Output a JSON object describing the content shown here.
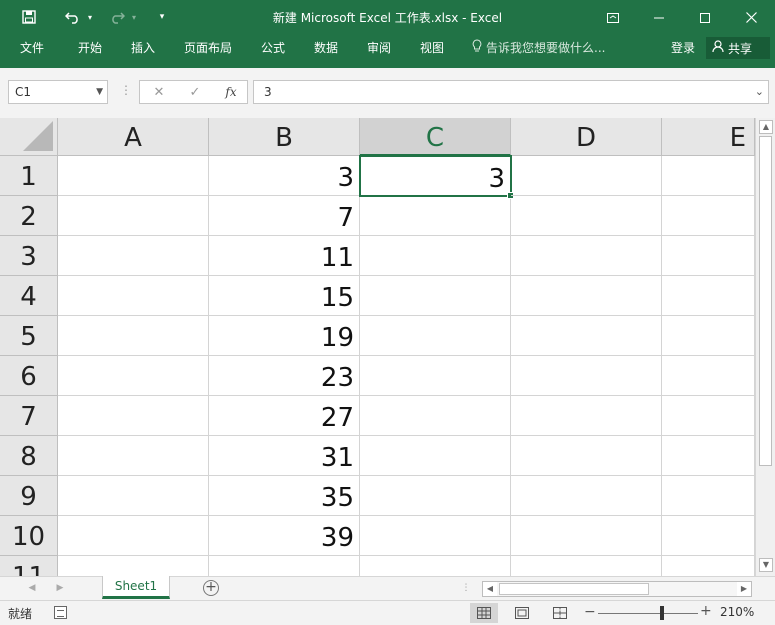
{
  "window": {
    "title": "新建 Microsoft Excel 工作表.xlsx - Excel",
    "accent": "#217346"
  },
  "ribbon": {
    "tabs": [
      "文件",
      "开始",
      "插入",
      "页面布局",
      "公式",
      "数据",
      "审阅",
      "视图"
    ],
    "tell_me": "告诉我您想要做什么...",
    "login": "登录",
    "share": "共享"
  },
  "formula_bar": {
    "name_box": "C1",
    "formula": "3"
  },
  "sheet": {
    "columns": [
      "A",
      "B",
      "C",
      "D",
      "E"
    ],
    "rows": [
      "1",
      "2",
      "3",
      "4",
      "5",
      "6",
      "7",
      "8",
      "9",
      "10",
      "11"
    ],
    "column_b": [
      "3",
      "7",
      "11",
      "15",
      "19",
      "23",
      "27",
      "31",
      "35",
      "39"
    ],
    "c1": "3",
    "selected_cell": "C1"
  },
  "tabs": {
    "sheet1": "Sheet1"
  },
  "status": {
    "ready": "就绪",
    "zoom": "210%"
  }
}
